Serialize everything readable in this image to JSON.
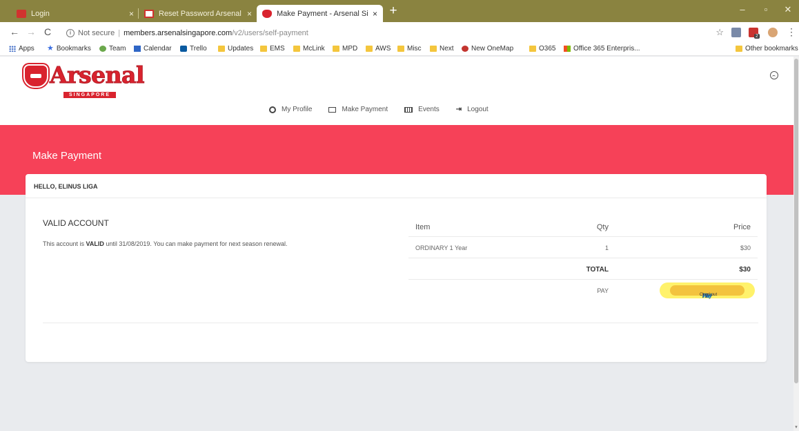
{
  "browser": {
    "tabs": [
      {
        "title": "Login",
        "favicon": "red-favicon",
        "active": false
      },
      {
        "title": "Reset Password Arsenal Singapo",
        "favicon": "gmail-favicon",
        "active": false
      },
      {
        "title": "Make Payment - Arsenal Singapo",
        "favicon": "arsenal-favicon",
        "active": true
      }
    ],
    "tab_close": "×",
    "new_tab": "+",
    "window_controls": {
      "minimize": "–",
      "maximize": "▫",
      "close": "✕"
    },
    "nav": {
      "back": "←",
      "forward": "→",
      "reload": "C"
    },
    "address": {
      "security": "Not secure",
      "separator": "|",
      "host": "members.arsenalsingapore.com",
      "path": "/v2/users/self-payment"
    },
    "star": "☆",
    "extension_badge": "2",
    "menu": "⋮",
    "bookmarks": [
      {
        "label": "Apps",
        "icon": "apps-icon"
      },
      {
        "label": "Bookmarks",
        "icon": "star-icon"
      },
      {
        "label": "Team",
        "icon": "team-icon"
      },
      {
        "label": "Calendar",
        "icon": "calendar-icon"
      },
      {
        "label": "Trello",
        "icon": "trello-icon"
      },
      {
        "label": "Updates",
        "icon": "folder-icon"
      },
      {
        "label": "EMS",
        "icon": "folder-icon"
      },
      {
        "label": "McLink",
        "icon": "folder-icon"
      },
      {
        "label": "MPD",
        "icon": "folder-icon"
      },
      {
        "label": "AWS",
        "icon": "folder-icon"
      },
      {
        "label": "Misc",
        "icon": "folder-icon"
      },
      {
        "label": "Next",
        "icon": "folder-icon"
      },
      {
        "label": "New OneMap",
        "icon": "onemap-icon"
      },
      {
        "label": "O365",
        "icon": "folder-icon"
      },
      {
        "label": "Office 365 Enterpris...",
        "icon": "office-icon"
      }
    ],
    "other_bookmarks": "Other bookmarks"
  },
  "site": {
    "logo": {
      "word": "Arsenal",
      "sub": "SINGAPORE"
    },
    "nav": [
      {
        "label": "My Profile",
        "icon": "user-circle-icon"
      },
      {
        "label": "Make Payment",
        "icon": "id-card-icon"
      },
      {
        "label": "Events",
        "icon": "calendar-grid-icon"
      },
      {
        "label": "Logout",
        "icon": "logout-icon"
      }
    ]
  },
  "page": {
    "title": "Make Payment",
    "greeting": "HELLO, ELINUS LIGA",
    "account": {
      "heading": "VALID ACCOUNT",
      "text_before": "This account is ",
      "status": "VALID",
      "text_after": " until 31/08/2019. You can make payment for next season renewal."
    },
    "order": {
      "headers": {
        "item": "Item",
        "qty": "Qty",
        "price": "Price"
      },
      "line": {
        "item": "ORDINARY 1 Year",
        "qty": "1",
        "price": "$30"
      },
      "total_label": "TOTAL",
      "total_value": "$30",
      "pay_label": "PAY"
    },
    "paypal": {
      "p": "P",
      "pay": "Pay",
      "pal": "Pal",
      "checkout": "Checkout"
    }
  },
  "colors": {
    "banner": "#f64158",
    "brand_red": "#d9232e",
    "paypal_gold": "#f3c33e",
    "highlight": "#fff26b",
    "chrome_frame": "#8a8340"
  }
}
